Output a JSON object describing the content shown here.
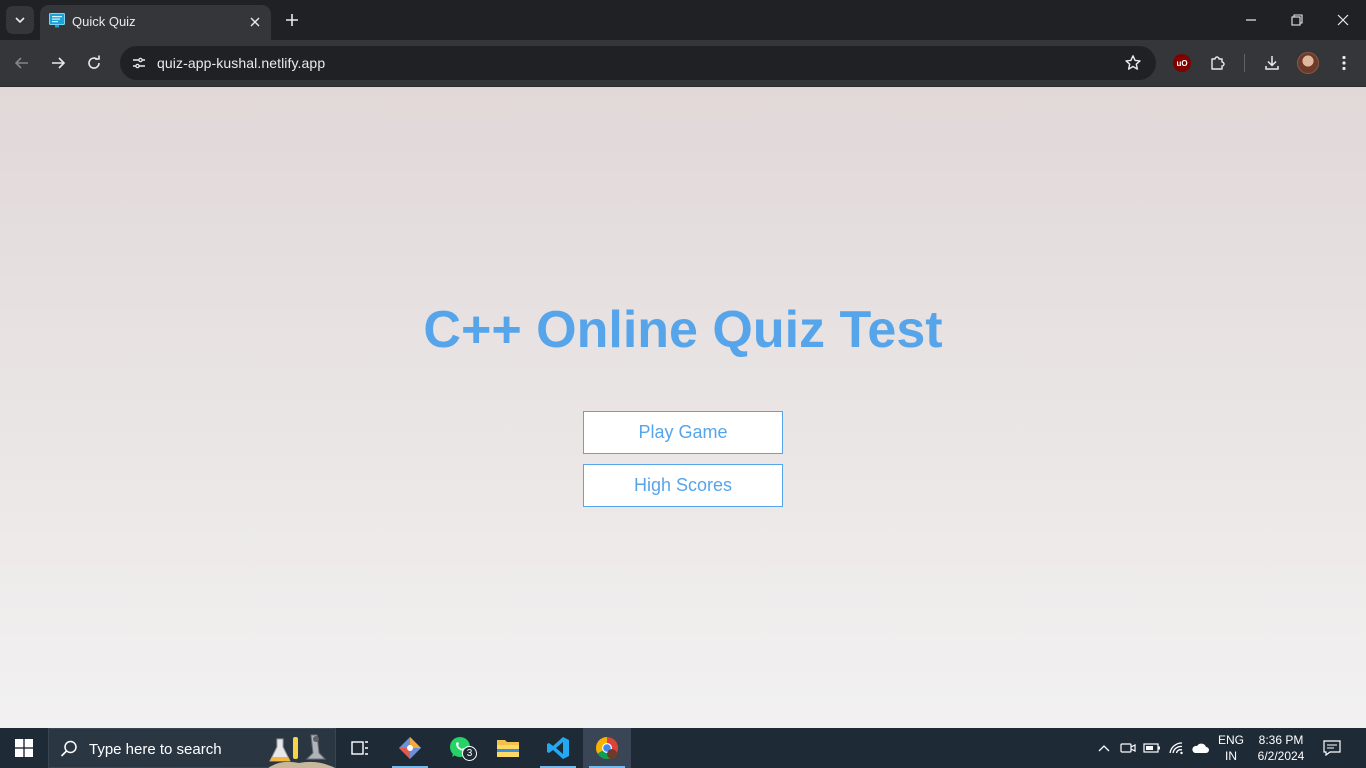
{
  "browser": {
    "tab": {
      "title": "Quick Quiz"
    },
    "address_bar": {
      "url": "quiz-app-kushal.netlify.app"
    },
    "extensions": {
      "ublock_label": "uO"
    }
  },
  "page": {
    "title": "C++ Online Quiz Test",
    "buttons": {
      "play": "Play Game",
      "high_scores": "High Scores"
    },
    "colors": {
      "accent": "#56a5eb",
      "bg_top": "#e1d8d8",
      "bg_bottom": "#f2f1f1"
    }
  },
  "taskbar": {
    "search_placeholder": "Type here to search",
    "whatsapp_badge": "3",
    "language": {
      "line1": "ENG",
      "line2": "IN"
    },
    "clock": {
      "time": "8:36 PM",
      "date": "6/2/2024"
    }
  }
}
